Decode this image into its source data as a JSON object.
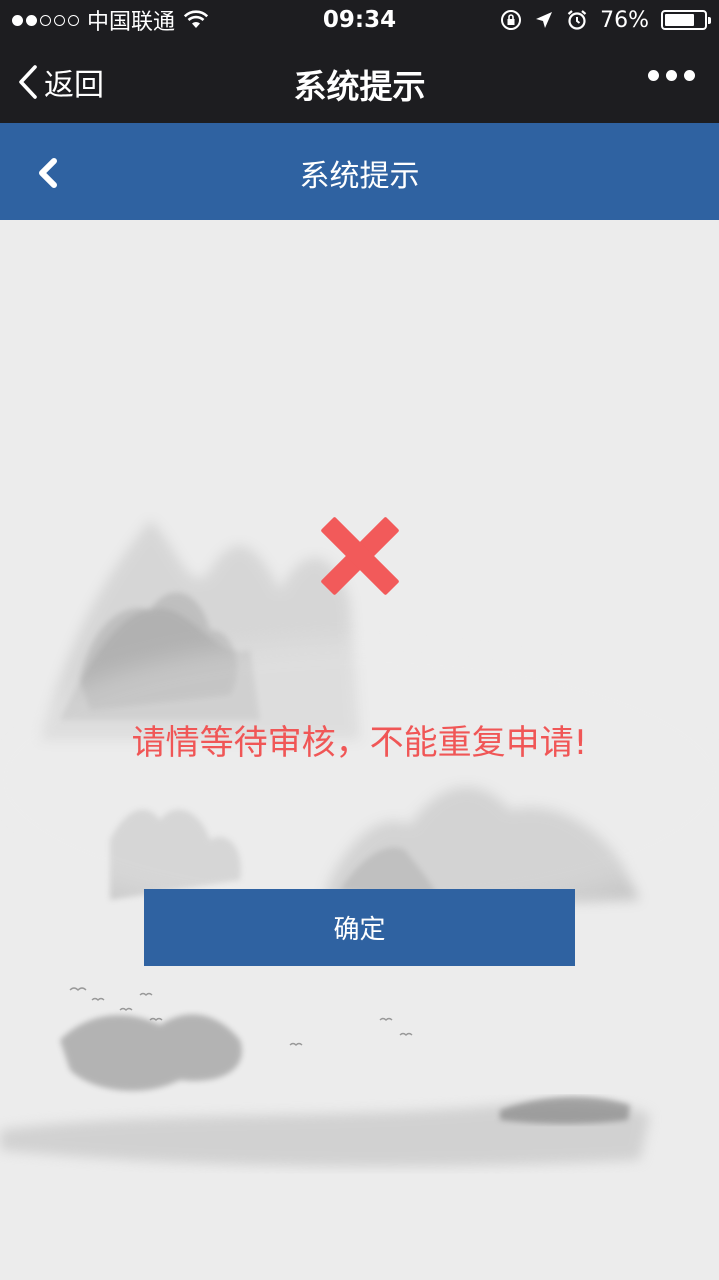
{
  "status_bar": {
    "carrier": "中国联通",
    "time": "09:34",
    "battery": "76%",
    "battery_level": 0.76,
    "signal_bars": 2,
    "icons": [
      "wifi-icon",
      "orientation-lock-icon",
      "location-icon",
      "alarm-icon",
      "battery-icon"
    ]
  },
  "nav_bar": {
    "back_label": "返回",
    "title": "系统提示",
    "more_icon": "more-dots-icon"
  },
  "page_header": {
    "back_icon": "chevron-left-icon",
    "title": "系统提示"
  },
  "content": {
    "status_icon": "error-x-icon",
    "message": "请情等待审核，不能重复申请!",
    "confirm_label": "确定"
  },
  "colors": {
    "dark_bar": "#1d1d20",
    "brand_blue": "#2f62a1",
    "error_red": "#f05656",
    "background": "#ececec"
  }
}
